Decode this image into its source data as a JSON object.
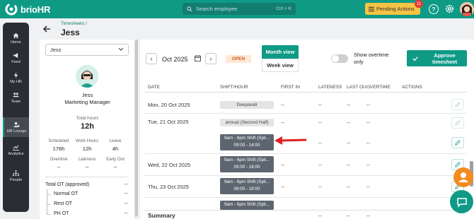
{
  "app": {
    "logo_text": "brioHR",
    "search_placeholder": "Search employee",
    "search_shortcut": "Ctrl + K",
    "pending_label": "Pending Actions",
    "pending_count": "11"
  },
  "nav": [
    {
      "label": "Home",
      "icon": "home-icon"
    },
    {
      "label": "Feed",
      "icon": "megaphone-icon"
    },
    {
      "label": "My HR",
      "icon": "lightning-icon"
    },
    {
      "label": "Team",
      "icon": "team-icon"
    },
    {
      "label": "HR Lounge",
      "icon": "lounge-icon",
      "active": true
    },
    {
      "label": "Analytics",
      "icon": "analytics-icon"
    },
    {
      "label": "People",
      "icon": "people-icon"
    }
  ],
  "header": {
    "breadcrumb": "Timesheets",
    "breadcrumb_sep": "/",
    "title": "Jess"
  },
  "employee": {
    "select_value": "Jess",
    "name": "Jess",
    "role": "Marketing Manager",
    "total_hours_label": "Total hours",
    "total_hours": "12h",
    "stats_row1": [
      {
        "label": "Scheduled",
        "value": "176h"
      },
      {
        "label": "Work Hours",
        "value": "12h"
      },
      {
        "label": "Leave",
        "value": "4h"
      }
    ],
    "stats_row2": [
      {
        "label": "Overtime",
        "value": "--"
      },
      {
        "label": "Lateness",
        "value": "--"
      },
      {
        "label": "Early Out",
        "value": "--"
      }
    ],
    "total_ot_label": "Total OT (approved)",
    "total_ot_value": "--",
    "ot_items": [
      {
        "label": "Normal OT",
        "value": "--"
      },
      {
        "label": "Rest OT",
        "value": "--"
      },
      {
        "label": "PH OT",
        "value": "--"
      }
    ]
  },
  "toolbar": {
    "prev": "‹",
    "next": "›",
    "month": "Oct 2025",
    "status": "OPEN",
    "month_view": "Month view",
    "week_view": "Week view",
    "overtime_toggle_label": "Show overtime only",
    "approve_label": "Approve timesheet"
  },
  "table": {
    "headers": [
      "DATE",
      "SHIFT/HOUR",
      "FIRST IN",
      "LATENESS",
      "LAST OU",
      "OVERTIME",
      "ACTIONS"
    ],
    "rows": [
      {
        "date": "Mon, 20 Oct 2025",
        "chip": "Deepavali",
        "first_in": "--",
        "lateness": "--",
        "last_out": "--",
        "overtime": "--"
      },
      {
        "date": "Tue, 21 Oct 2025",
        "chip": "annual (Second Half)",
        "first_in": "--",
        "lateness": "--",
        "last_out": "--",
        "overtime": "--"
      },
      {
        "date": "",
        "shift_line1": "9am - 6pm Shift (Spli...",
        "shift_line2": "09:00 - 14:00",
        "first_in": "--",
        "lateness": "--",
        "last_out": "--",
        "overtime": "--"
      },
      {
        "date": "Wed, 22 Oct 2025",
        "shift_line1": "9am - 6pm Shift (Spli...",
        "shift_line2": "09:00 - 18:00",
        "first_in": "--",
        "lateness": "--",
        "last_out": "--",
        "overtime": "--"
      },
      {
        "date": "Thu, 23 Oct 2025",
        "shift_line1": "9am - 6pm Shift (Spli...",
        "shift_line2": "09:00 - 18:00",
        "first_in": "--",
        "lateness": "--",
        "last_out": "--",
        "overtime": "--"
      },
      {
        "date": "",
        "shift_line1": "9am - 6pm Shift (Spli..."
      }
    ],
    "summary_label": "Summary",
    "summary_values": [
      "--",
      "--",
      "--"
    ]
  },
  "colors": {
    "brand": "#0f9a86",
    "pending": "#f6c343",
    "open_badge_bg": "#fde7d6",
    "open_badge_text": "#d45a1c",
    "arrow": "#e02020",
    "shift_chip": "#5d6670"
  }
}
